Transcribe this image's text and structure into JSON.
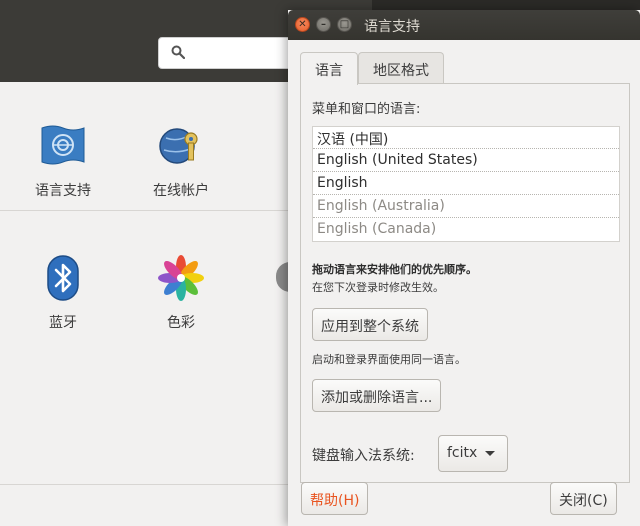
{
  "background": {
    "search_placeholder": "",
    "items": [
      {
        "label": "语言支持",
        "icon": "language-flag-icon"
      },
      {
        "label": "在线帐户",
        "icon": "online-accounts-icon"
      },
      {
        "label": "蓝牙",
        "icon": "bluetooth-icon"
      },
      {
        "label": "色彩",
        "icon": "color-icon"
      }
    ]
  },
  "dialog": {
    "title": "语言支持",
    "tabs": [
      {
        "label": "语言",
        "active": true
      },
      {
        "label": "地区格式",
        "active": false
      }
    ],
    "menu_lang_label": "菜单和窗口的语言:",
    "languages": [
      {
        "label": "汉语 (中国)",
        "enabled": true
      },
      {
        "label": "English (United States)",
        "enabled": true
      },
      {
        "label": "English",
        "enabled": true
      },
      {
        "label": "English (Australia)",
        "enabled": false
      },
      {
        "label": "English (Canada)",
        "enabled": false
      }
    ],
    "hint_bold": "拖动语言来安排他们的优先顺序。",
    "hint_sub": "在您下次登录时修改生效。",
    "apply_button": "应用到整个系统",
    "login_hint": "启动和登录界面使用同一语言。",
    "add_remove_button": "添加或删除语言...",
    "ime_label": "键盘输入法系统:",
    "ime_value": "fcitx",
    "help_button": "帮助(H)",
    "close_button": "关闭(C)"
  },
  "colors": {
    "accent": "#e95420",
    "titlebar": "#3c3b37"
  }
}
